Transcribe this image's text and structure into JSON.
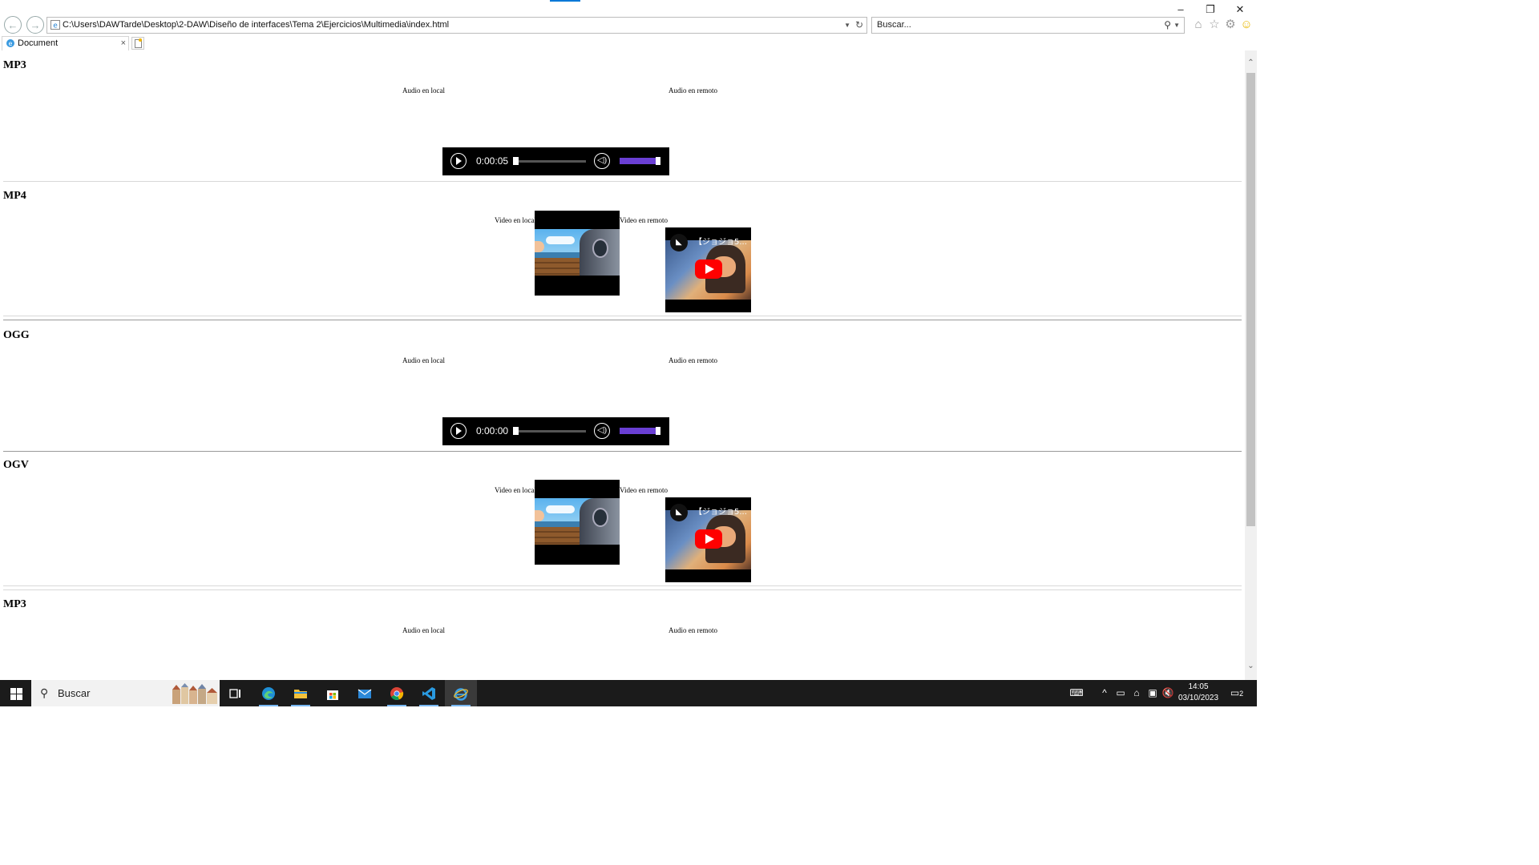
{
  "window": {
    "minimize": "–",
    "restore": "❐",
    "close": "✕"
  },
  "toolbar": {
    "address_url": "C:\\Users\\DAWTarde\\Desktop\\2-DAW\\Diseño de interfaces\\Tema 2\\Ejercicios\\Multimedia\\index.html",
    "search_placeholder": "Buscar...",
    "icons": [
      "back-icon",
      "forward-icon",
      "home-icon",
      "favorites-star-icon",
      "settings-gear-icon",
      "smiley-feedback-icon"
    ]
  },
  "tabs": [
    {
      "title": "Document",
      "close": "×"
    }
  ],
  "page": {
    "sections": [
      {
        "heading": "MP3",
        "type": "audio",
        "local_caption": "Audio en local",
        "remote_caption": "Audio en remoto",
        "time": "0:00:05"
      },
      {
        "heading": "MP4",
        "type": "video",
        "local_caption": "Video en local",
        "remote_caption": "Video en remoto",
        "remote_title": "【ジョジョ5..."
      },
      {
        "heading": "OGG",
        "type": "audio",
        "local_caption": "Audio en local",
        "remote_caption": "Audio en remoto",
        "time": "0:00:00"
      },
      {
        "heading": "OGV",
        "type": "video",
        "local_caption": "Video en local",
        "remote_caption": "Video en remoto",
        "remote_title": "【ジョジョ5..."
      },
      {
        "heading": "MP3",
        "type": "audio",
        "local_caption": "Audio en local",
        "remote_caption": "Audio en remoto"
      }
    ]
  },
  "taskbar": {
    "search_label": "Buscar",
    "apps": [
      "task-view",
      "edge",
      "file-explorer",
      "store",
      "mail",
      "chrome",
      "vscode",
      "internet-explorer"
    ],
    "active_app": "internet-explorer",
    "time": "14:05",
    "date": "03/10/2023",
    "notification_count": "2"
  },
  "colors": {
    "volume_fill": "#6a3fd4",
    "youtube_red": "#ff0000",
    "taskbar": "#1b1b1b",
    "accent": "#0078d7"
  },
  "media_levels": {
    "volume_fraction": 0.9
  }
}
